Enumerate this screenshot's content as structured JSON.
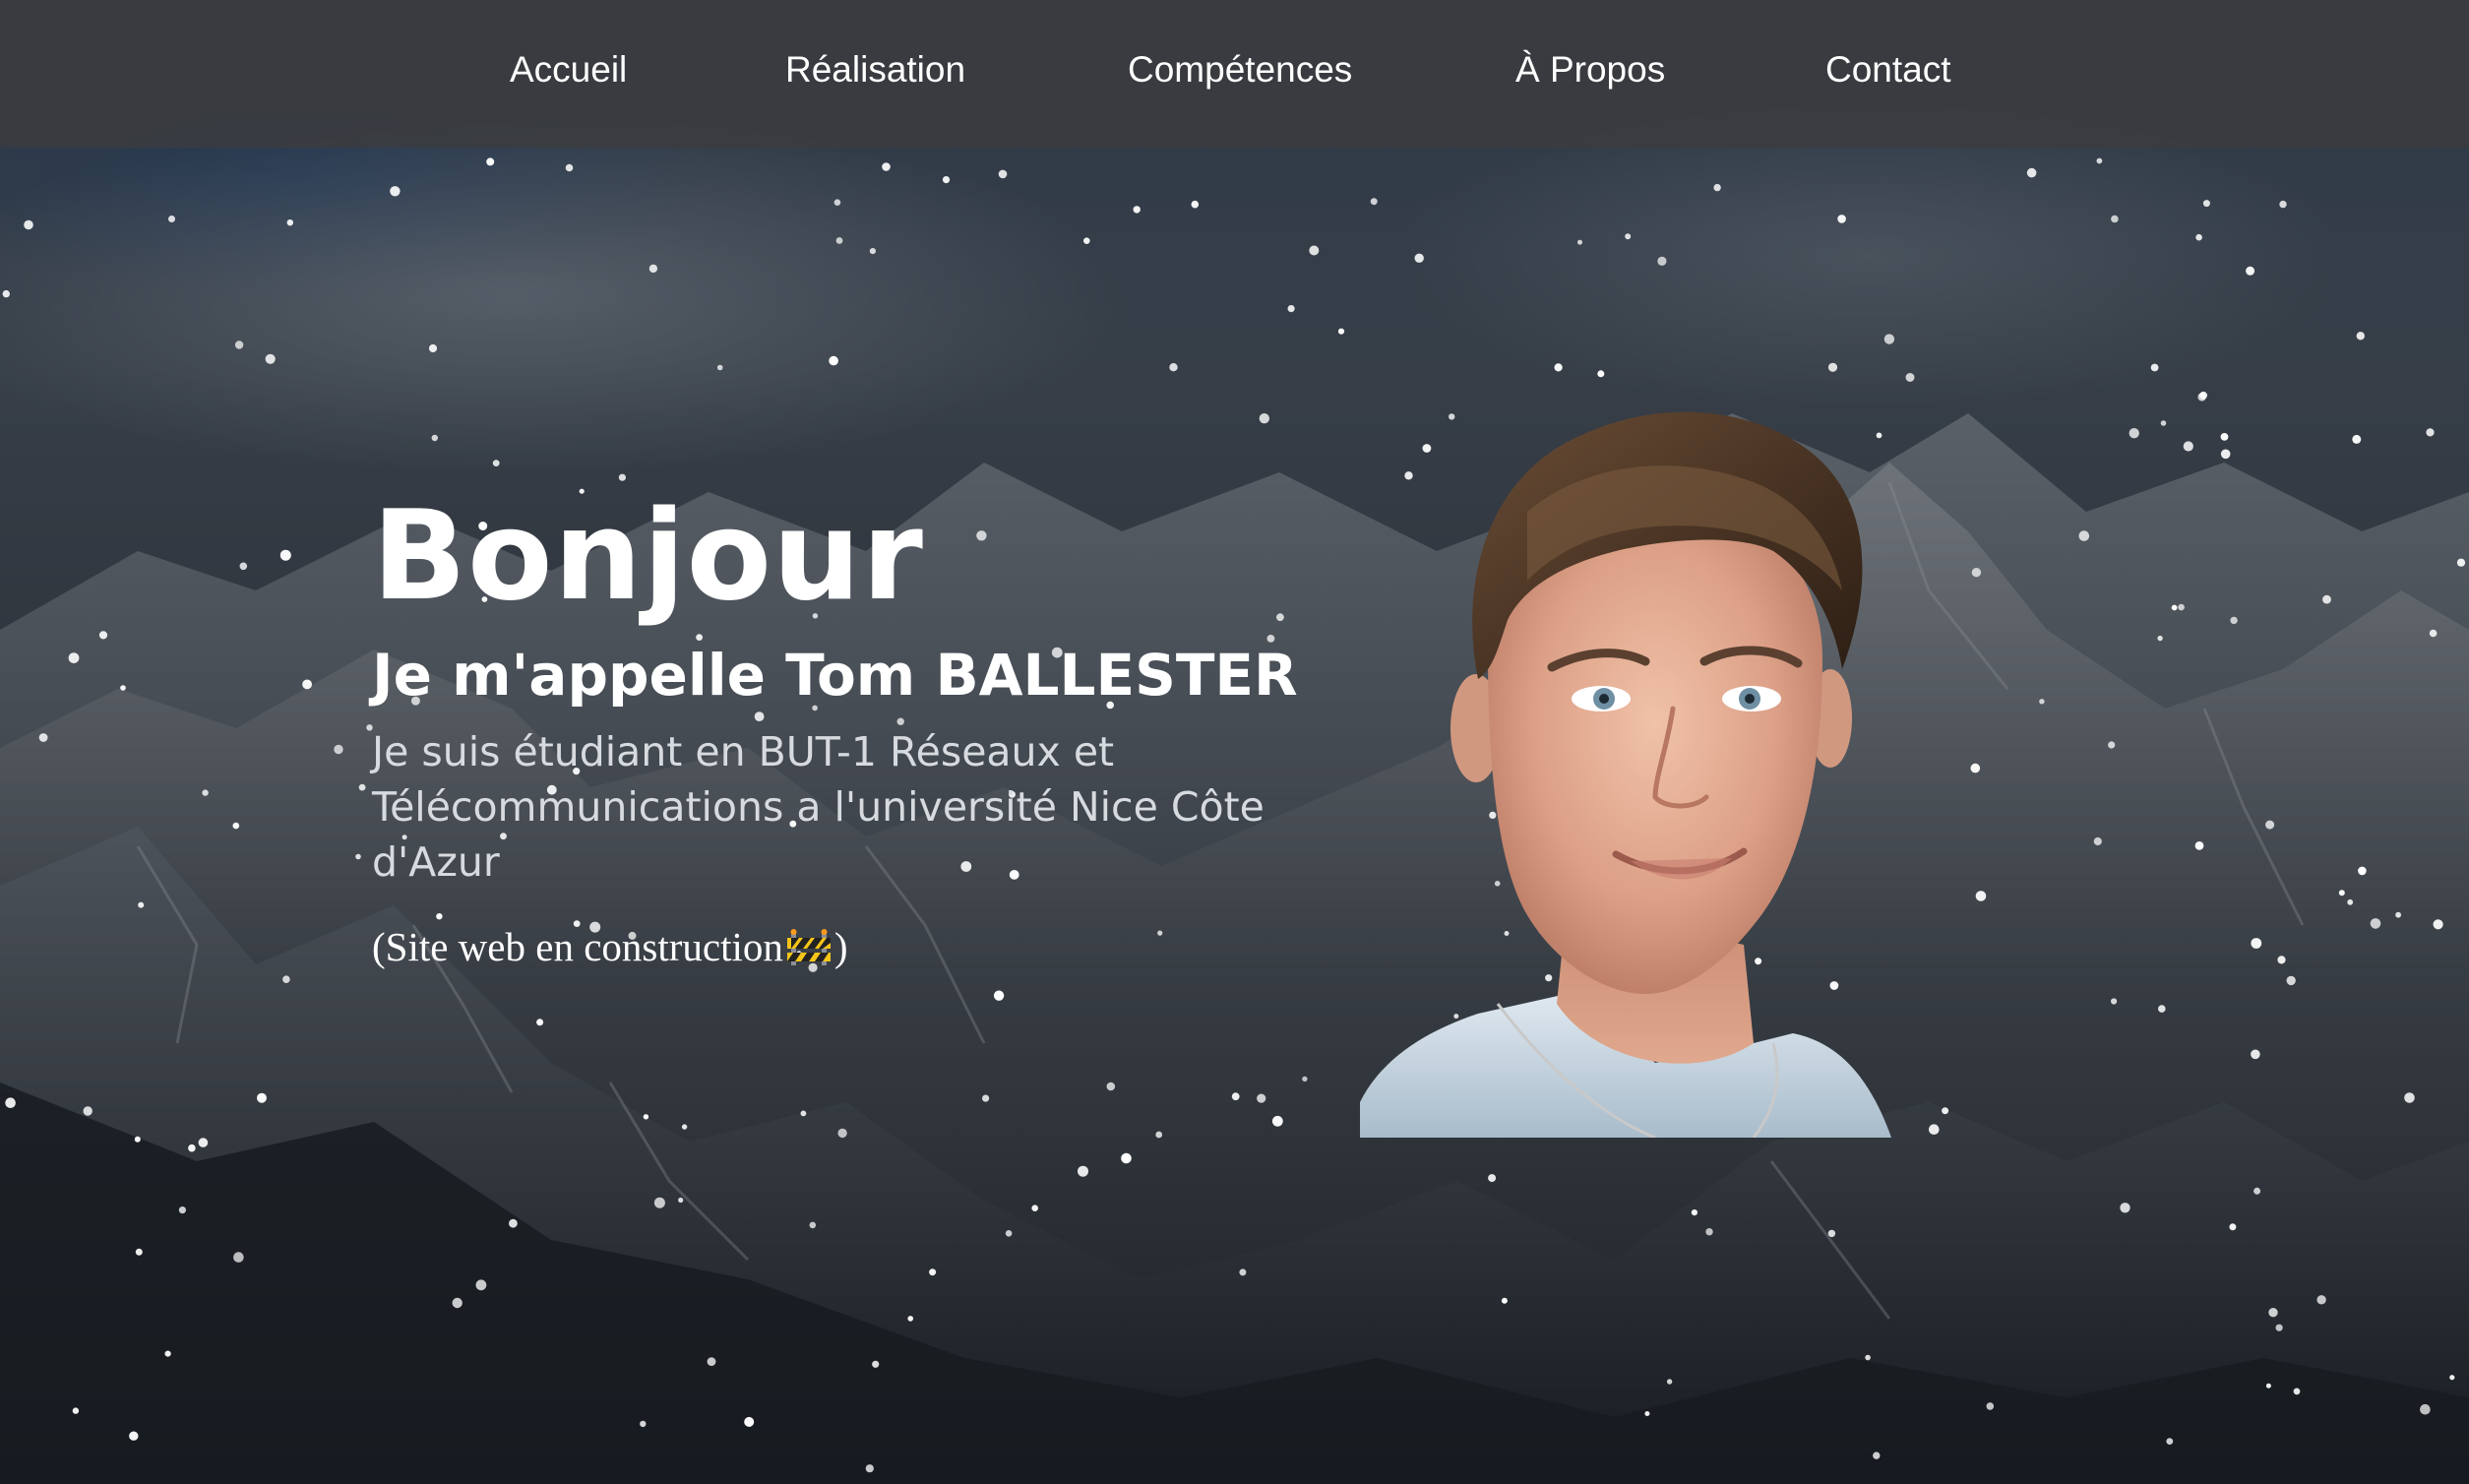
{
  "nav": {
    "items": [
      {
        "label": "Accueil"
      },
      {
        "label": "Réalisation"
      },
      {
        "label": "Compétences"
      },
      {
        "label": "À Propos"
      },
      {
        "label": "Contact"
      }
    ]
  },
  "hero": {
    "title": "Bonjour",
    "subtitle": "Je m'appelle Tom BALLESTER",
    "description": "Je suis étudiant en BUT-1 Réseaux et Télécommunications a l'université Nice Côte d'Azur",
    "note_prefix": "(Site web en construction",
    "note_suffix": ")",
    "note_icon": "construction-icon"
  },
  "portrait": {
    "icon": "portrait-photo"
  },
  "colors": {
    "nav_background": "#3c3c3e",
    "text": "#ffffff",
    "description_text": "#d7dbe0"
  }
}
